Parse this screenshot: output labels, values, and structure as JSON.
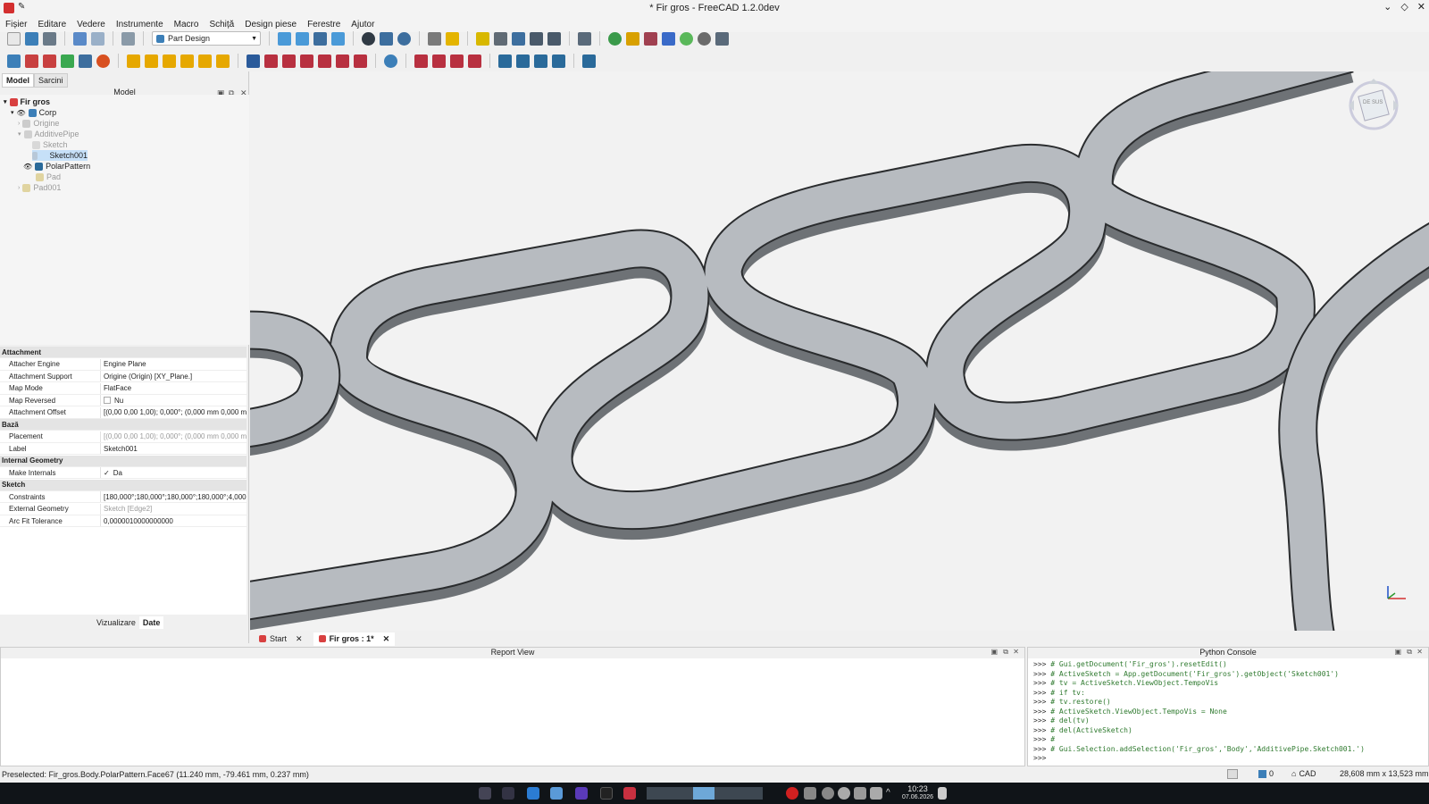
{
  "window": {
    "title": "* Fir gros - FreeCAD 1.2.0dev"
  },
  "menu": [
    "Fișier",
    "Editare",
    "Vedere",
    "Instrumente",
    "Macro",
    "Schiță",
    "Design piese",
    "Ferestre",
    "Ajutor"
  ],
  "toolbar": {
    "workbench": "Part Design"
  },
  "panel_tabs": [
    "Model",
    "Sarcini"
  ],
  "tree": {
    "header": "Model",
    "items": [
      {
        "label": "Fir gros",
        "bold": true
      },
      {
        "label": "Corp"
      },
      {
        "label": "Origine",
        "dim": true
      },
      {
        "label": "AdditivePipe",
        "dim": true
      },
      {
        "label": "Sketch",
        "dim": true
      },
      {
        "label": "Sketch001",
        "selected": true
      },
      {
        "label": "PolarPattern"
      },
      {
        "label": "Pad",
        "dim": true
      },
      {
        "label": "Pad001",
        "dim": true
      }
    ]
  },
  "properties": [
    {
      "group": "Attachment"
    },
    {
      "key": "Attacher Engine",
      "value": "Engine Plane"
    },
    {
      "key": "Attachment Support",
      "value": "Origine (Origin) [XY_Plane.]"
    },
    {
      "key": "Map Mode",
      "value": "FlatFace"
    },
    {
      "key": "Map Reversed",
      "value": "Nu"
    },
    {
      "key": "Attachment Offset",
      "value": "[(0,00 0,00 1,00); 0,000°; (0,000 mm  0,000 m..."
    },
    {
      "group": "Bază"
    },
    {
      "key": "Placement",
      "value": "[(0,00 0,00 1,00); 0,000°; (0,000 mm  0,000 m...",
      "dim": true
    },
    {
      "key": "Label",
      "value": "Sketch001"
    },
    {
      "group": "Internal Geometry"
    },
    {
      "key": "Make Internals",
      "value": "Da"
    },
    {
      "group": "Sketch"
    },
    {
      "key": "Constraints",
      "value": "[180,000°;180,000°;180,000°;180,000°;4,000 ..."
    },
    {
      "key": "External Geometry",
      "value": "Sketch [Edge2]",
      "dim": true
    },
    {
      "key": "Arc Fit Tolerance",
      "value": "0,0000010000000000"
    }
  ],
  "view_tabs": [
    "Vizualizare",
    "Date"
  ],
  "doc_tabs": [
    "Start",
    "Fir gros : 1*"
  ],
  "report": {
    "title": "Report View"
  },
  "python": {
    "title": "Python Console",
    "lines": [
      "# Gui.getDocument('Fir_gros').resetEdit()",
      "# ActiveSketch = App.getDocument('Fir_gros').getObject('Sketch001')",
      "# tv = ActiveSketch.ViewObject.TempoVis",
      "# if tv:",
      "#   tv.restore()",
      "# ActiveSketch.ViewObject.TempoVis = None",
      "# del(tv)",
      "# del(ActiveSketch)",
      "#",
      "# Gui.Selection.addSelection('Fir_gros','Body','AdditivePipe.Sketch001.')",
      ""
    ],
    "prompt": ">>>"
  },
  "status": {
    "message": "Preselected: Fir_gros.Body.PolarPattern.Face67 (11.240 mm, -79.461 mm, 0.237 mm)",
    "count": "0",
    "nav": "CAD",
    "dimensions": "28,608 mm x 13,523 mm"
  },
  "taskbar": {
    "time": "10:23",
    "date": "07.06.2026"
  },
  "navcube": {
    "face": "DE SUS"
  },
  "colors": {
    "part": "#b7bbc0",
    "part_side": "#6e7276",
    "accent": "#3b8ed8",
    "selection": "#c6e0f8"
  }
}
